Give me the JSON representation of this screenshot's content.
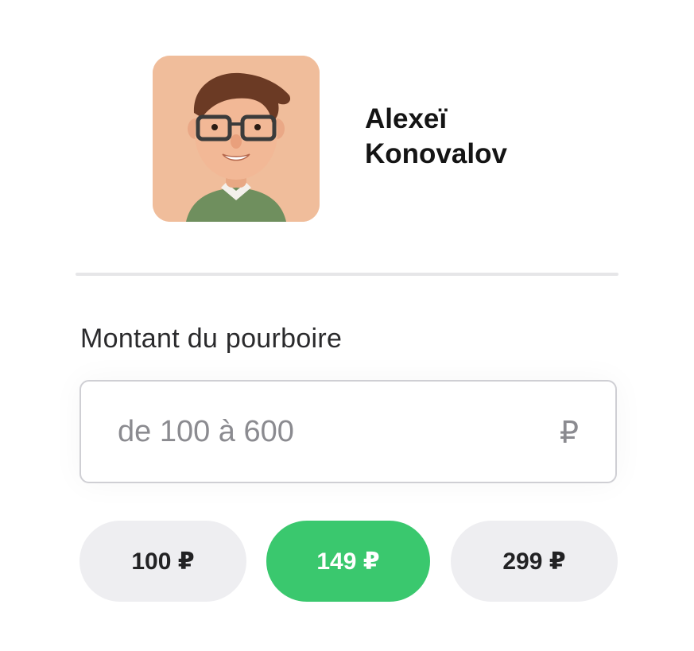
{
  "recipient": {
    "avatar": "avatar-illustration",
    "first_name": "Alexeï",
    "last_name": "Konovalov"
  },
  "tip": {
    "label": "Montant du pourboire",
    "input": {
      "value": "",
      "placeholder": "de 100 à 600",
      "currency": "₽"
    },
    "presets": [
      {
        "label": "100 ₽",
        "selected": false
      },
      {
        "label": "149 ₽",
        "selected": true
      },
      {
        "label": "299 ₽",
        "selected": false
      }
    ]
  },
  "colors": {
    "accent": "#3ac86e",
    "chip_bg": "#eeeef1",
    "avatar_bg": "#f0bd9b"
  }
}
